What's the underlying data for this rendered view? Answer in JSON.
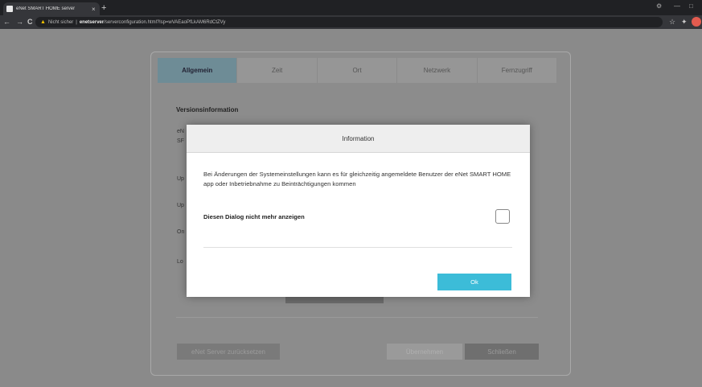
{
  "browser": {
    "tab_title": "eNet SMART HOME server",
    "tab_close": "×",
    "new_tab": "+",
    "url_warning": "Nicht sicher",
    "url_host": "enetserver",
    "url_path": "/serverconfiguration.html?lsp=wVAEaoPfLkAM6RdCtZVy",
    "back": "←",
    "forward": "→",
    "reload": "C",
    "bookmark_icon": "star-icon",
    "extension_icon": "puzzle-icon"
  },
  "page": {
    "tabs": [
      {
        "label": "Allgemein",
        "active": true
      },
      {
        "label": "Zeit",
        "active": false
      },
      {
        "label": "Ort",
        "active": false
      },
      {
        "label": "Netzwerk",
        "active": false
      },
      {
        "label": "Fernzugriff",
        "active": false
      }
    ],
    "section_title": "Versionsinformation",
    "bg_labels": [
      "eN",
      "SF",
      "Up",
      "Up",
      "On",
      "Lo"
    ],
    "reset_button": "eNet Server zurücksetzen",
    "disabled_button": "Übernehmen",
    "close_button": "Schließen"
  },
  "dialog": {
    "title": "Information",
    "message": "Bei Änderungen der Systemeinstellungen kann es für gleichzeitig angemeldete Benutzer der eNet SMART HOME app oder Inbetriebnahme zu Beinträchtigungen kommen",
    "checkbox_label": "Diesen Dialog nicht mehr anzeigen",
    "checkbox_checked": false,
    "ok_label": "Ok"
  },
  "colors": {
    "accent": "#3cbcd8",
    "active_tab": "#6e8c96"
  }
}
